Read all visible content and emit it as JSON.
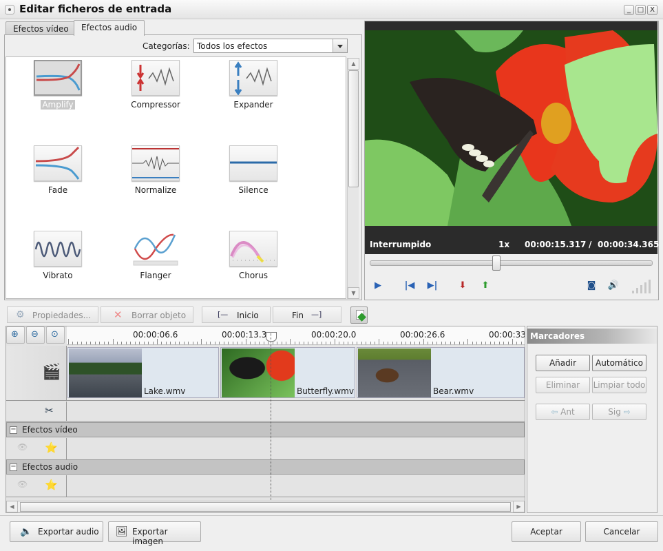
{
  "window": {
    "title": "Editar ficheros de entrada",
    "controls": [
      "_",
      "□",
      "X"
    ]
  },
  "tabs": [
    {
      "label": "Efectos vídeo",
      "active": false
    },
    {
      "label": "Efectos audio",
      "active": true
    }
  ],
  "category": {
    "label": "Categorías:",
    "value": "Todos los efectos"
  },
  "effects": [
    {
      "label": "Amplify",
      "icon": "amplify-icon",
      "selected": true
    },
    {
      "label": "Compressor",
      "icon": "compressor-icon"
    },
    {
      "label": "Expander",
      "icon": "expander-icon"
    },
    {
      "label": "Fade",
      "icon": "fade-icon"
    },
    {
      "label": "Normalize",
      "icon": "normalize-icon"
    },
    {
      "label": "Silence",
      "icon": "silence-icon"
    },
    {
      "label": "Vibrato",
      "icon": "vibrato-icon"
    },
    {
      "label": "Flanger",
      "icon": "flanger-icon"
    },
    {
      "label": "Chorus",
      "icon": "chorus-icon"
    }
  ],
  "player": {
    "status": "Interrumpido",
    "speed": "1x",
    "current_time": "00:00:15.317",
    "separator": "/",
    "total_time": "00:00:34.365",
    "progress": 0.4457
  },
  "toolbar": {
    "properties": "Propiedades...",
    "delete": "Borrar objeto",
    "start": "Inicio",
    "end": "Fin"
  },
  "ruler": {
    "labels": [
      "00:00:06.6",
      "00:00:13.3",
      "00:00:20.0",
      "00:00:26.6",
      "00:00:33"
    ]
  },
  "clips": [
    {
      "name": "Lake.wmv"
    },
    {
      "name": "Butterfly.wmv"
    },
    {
      "name": "Bear.wmv"
    }
  ],
  "groups": {
    "video_effects": "Efectos vídeo",
    "audio_effects": "Efectos audio"
  },
  "markers": {
    "title": "Marcadores",
    "add": "Añadir",
    "auto": "Automático",
    "remove": "Eliminar",
    "clear": "Limpiar todo",
    "prev": "Ant",
    "next": "Sig"
  },
  "footer": {
    "export_audio": "Exportar audio",
    "export_image": "Exportar imagen",
    "accept": "Aceptar",
    "cancel": "Cancelar"
  }
}
